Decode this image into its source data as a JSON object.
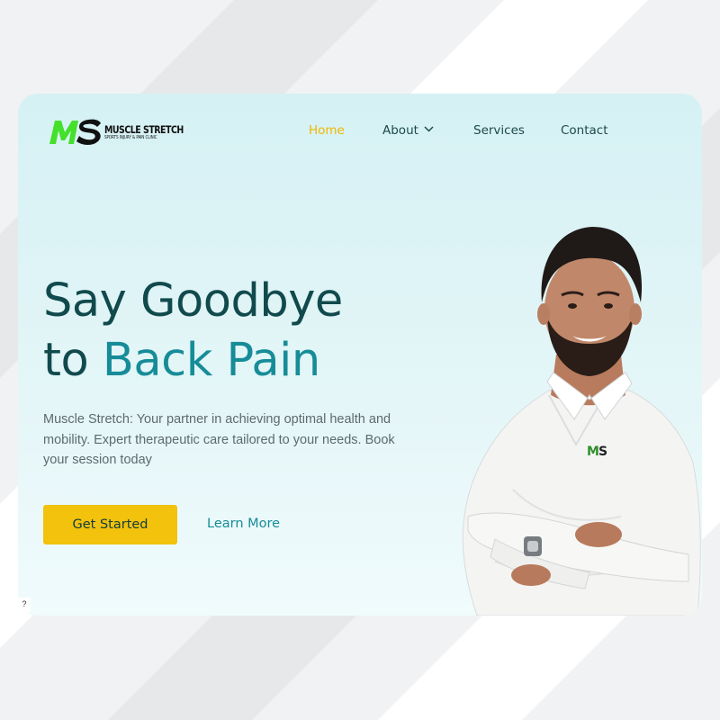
{
  "brand": {
    "logo_initials": "MS",
    "name": "MUSCLE STRETCH",
    "tagline": "SPORTS INJURY & PAIN CLINIC",
    "colors": {
      "green": "#44e02c",
      "dark": "#0e0e0e",
      "yellow": "#f2c20c",
      "teal": "#168c98",
      "dark_teal": "#114a4d"
    }
  },
  "nav": {
    "items": [
      {
        "label": "Home",
        "active": true
      },
      {
        "label": "About",
        "active": false,
        "icon": "chevron-down-icon"
      },
      {
        "label": "Services",
        "active": false
      },
      {
        "label": "Contact",
        "active": false
      }
    ]
  },
  "hero": {
    "title_line1": "Say Goodbye",
    "title_line2_prefix": "to ",
    "title_line2_accent": "Back Pain",
    "subtitle": "Muscle Stretch: Your partner in achieving optimal health and mobility. Expert therapeutic care tailored to your needs. Book your session today",
    "primary_cta": "Get Started",
    "secondary_cta": "Learn More",
    "image": "smiling-therapist-photo"
  },
  "corner_badge": "?"
}
